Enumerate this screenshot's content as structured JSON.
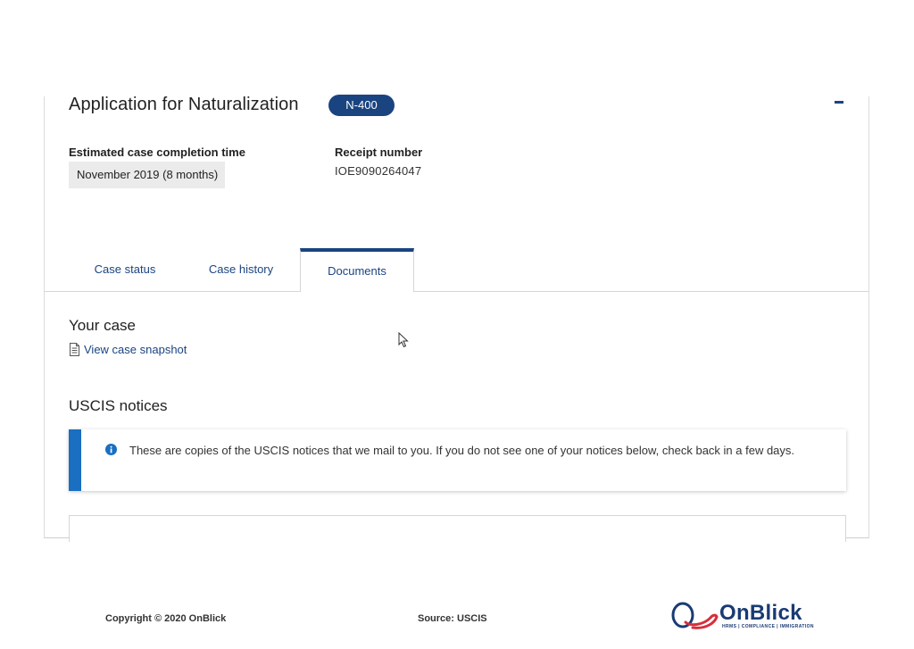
{
  "case": {
    "title": "Application for Naturalization",
    "form_badge": "N-400",
    "estimated_label": "Estimated case completion time",
    "estimated_value": "November 2019 (8 months)",
    "receipt_label": "Receipt number",
    "receipt_value": "IOE9090264047"
  },
  "tabs": [
    {
      "label": "Case status",
      "active": false
    },
    {
      "label": "Case history",
      "active": false
    },
    {
      "label": "Documents",
      "active": true
    }
  ],
  "your_case": {
    "title": "Your case",
    "snapshot_link": "View case snapshot"
  },
  "notices": {
    "title": "USCIS notices",
    "alert_text": "These are copies of the USCIS notices that we mail to you. If you do not see one of your notices below, check back in a few days."
  },
  "footer": {
    "copyright": "Copyright © 2020 OnBlick",
    "source": "Source: USCIS",
    "brand_name": "OnBlick",
    "brand_tagline": "HRMS | COMPLIANCE | IMMIGRATION"
  },
  "colors": {
    "accent": "#1a4480",
    "alert_border": "#1a6fc0",
    "value_bg": "#ebebeb"
  },
  "icons": [
    "collapse-icon",
    "document-icon",
    "info-icon",
    "mouse-pointer-icon",
    "onblick-logo-icon"
  ]
}
